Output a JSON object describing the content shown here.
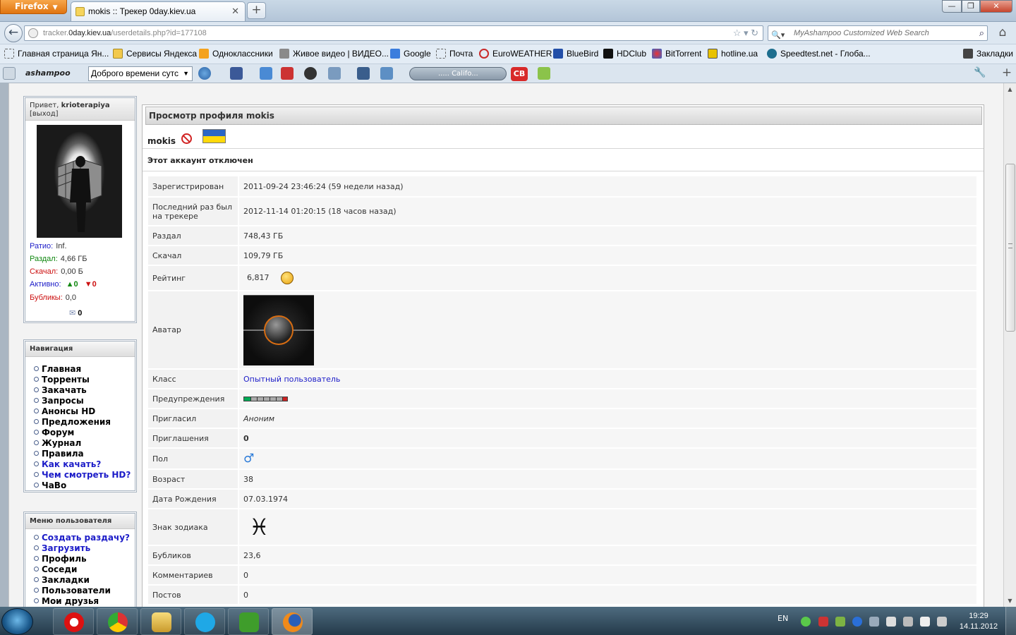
{
  "browser": {
    "menu_button": "Firefox",
    "tab_title": "mokis :: Трекер 0day.kiev.ua",
    "url_prefix": "tracker.",
    "url_host": "0day.kiev.ua",
    "url_path": "/userdetails.php?id=177108",
    "search_placeholder": "MyAshampoo Customized Web Search",
    "bookmarks": [
      "Главная страница Ян...",
      "Сервисы Яндекса",
      "Одноклассники",
      "Живое видео | ВИДЕО...",
      "Google",
      "Почта",
      "EuroWEATHER",
      "BlueBird",
      "HDClub",
      "BitTorrent",
      "hotline.ua",
      "Speedtest.net - Глоба..."
    ],
    "bookmarks_menu": "Закладки",
    "ashampoo_logo": "ashampoo",
    "ashampoo_select": "Доброго времени сутс",
    "player_text": "..... Califo...",
    "cb_label": "CB"
  },
  "sidebar": {
    "greeting": "Привет,",
    "username": "krioterapiya",
    "logout": "[выход]",
    "stats": [
      {
        "label": "Ратио:",
        "value": "Inf.",
        "color": "#1c1cc8"
      },
      {
        "label": "Раздал:",
        "value": "4,66 ГБ",
        "color": "#118811"
      },
      {
        "label": "Скачал:",
        "value": "0,00 Б",
        "color": "#cc1111"
      },
      {
        "label": "Активно:",
        "value": "",
        "color": "#1c1cc8"
      },
      {
        "label": "Бубликы:",
        "value": "0,0",
        "color": "#cc1111"
      }
    ],
    "active_up": "0",
    "active_down": "0",
    "messages": "0",
    "nav_title": "Навигация",
    "nav_items": [
      {
        "label": "Главная",
        "blue": false
      },
      {
        "label": "Торренты",
        "blue": false
      },
      {
        "label": "Закачать",
        "blue": false
      },
      {
        "label": "Запросы",
        "blue": false
      },
      {
        "label": "Анонсы HD",
        "blue": false
      },
      {
        "label": "Предложения",
        "blue": false
      },
      {
        "label": "Форум",
        "blue": false
      },
      {
        "label": "Журнал",
        "blue": false
      },
      {
        "label": "Правила",
        "blue": false
      },
      {
        "label": "Как качать?",
        "blue": true
      },
      {
        "label": "Чем смотреть HD?",
        "blue": true
      },
      {
        "label": "ЧаВо",
        "blue": false
      }
    ],
    "user_menu_title": "Меню пользователя",
    "user_menu_items": [
      {
        "label": "Создать раздачу?",
        "blue": true
      },
      {
        "label": "Загрузить",
        "blue": true
      },
      {
        "label": "Профиль",
        "blue": false
      },
      {
        "label": "Соседи",
        "blue": false
      },
      {
        "label": "Закладки",
        "blue": false
      },
      {
        "label": "Пользователи",
        "blue": false
      },
      {
        "label": "Мои друзья",
        "blue": false
      }
    ]
  },
  "profile": {
    "panel_title": "Просмотр профиля mokis",
    "username": "mokis",
    "disabled_text": "Этот аккаунт отключен",
    "rows": [
      {
        "key": "Зарегистрирован",
        "value": "2011-09-24 23:46:24 (59 недели назад)",
        "h": 28
      },
      {
        "key": "Последний раз был на трекере",
        "value": "2012-11-14 01:20:15 (18 часов назад)",
        "h": 39
      },
      {
        "key": "Раздал",
        "value": "748,43 ГБ",
        "h": 26
      },
      {
        "key": "Скачал",
        "value": "109,79 ГБ",
        "h": 26
      },
      {
        "key": "Рейтинг",
        "value": "6,817",
        "h": 34
      },
      {
        "key": "Аватар",
        "value": "",
        "h": 109
      },
      {
        "key": "Класс",
        "value": "Опытный пользователь",
        "h": 26
      },
      {
        "key": "Предупреждения",
        "value": "",
        "h": 26
      },
      {
        "key": "Пригласил",
        "value": "Аноним",
        "h": 26
      },
      {
        "key": "Приглашения",
        "value": "0",
        "h": 26
      },
      {
        "key": "Пол",
        "value": "♂",
        "h": 28
      },
      {
        "key": "Возраст",
        "value": "38",
        "h": 26
      },
      {
        "key": "Дата Рождения",
        "value": "07.03.1974",
        "h": 26
      },
      {
        "key": "Знак зодиака",
        "value": "♓",
        "h": 50
      },
      {
        "key": "Бубликов",
        "value": "23,6",
        "h": 26
      },
      {
        "key": "Комментариев",
        "value": "0",
        "h": 26
      },
      {
        "key": "Постов",
        "value": "0",
        "h": 26
      }
    ]
  },
  "taskbar": {
    "lang": "EN",
    "time": "19:29",
    "date": "14.11.2012"
  }
}
